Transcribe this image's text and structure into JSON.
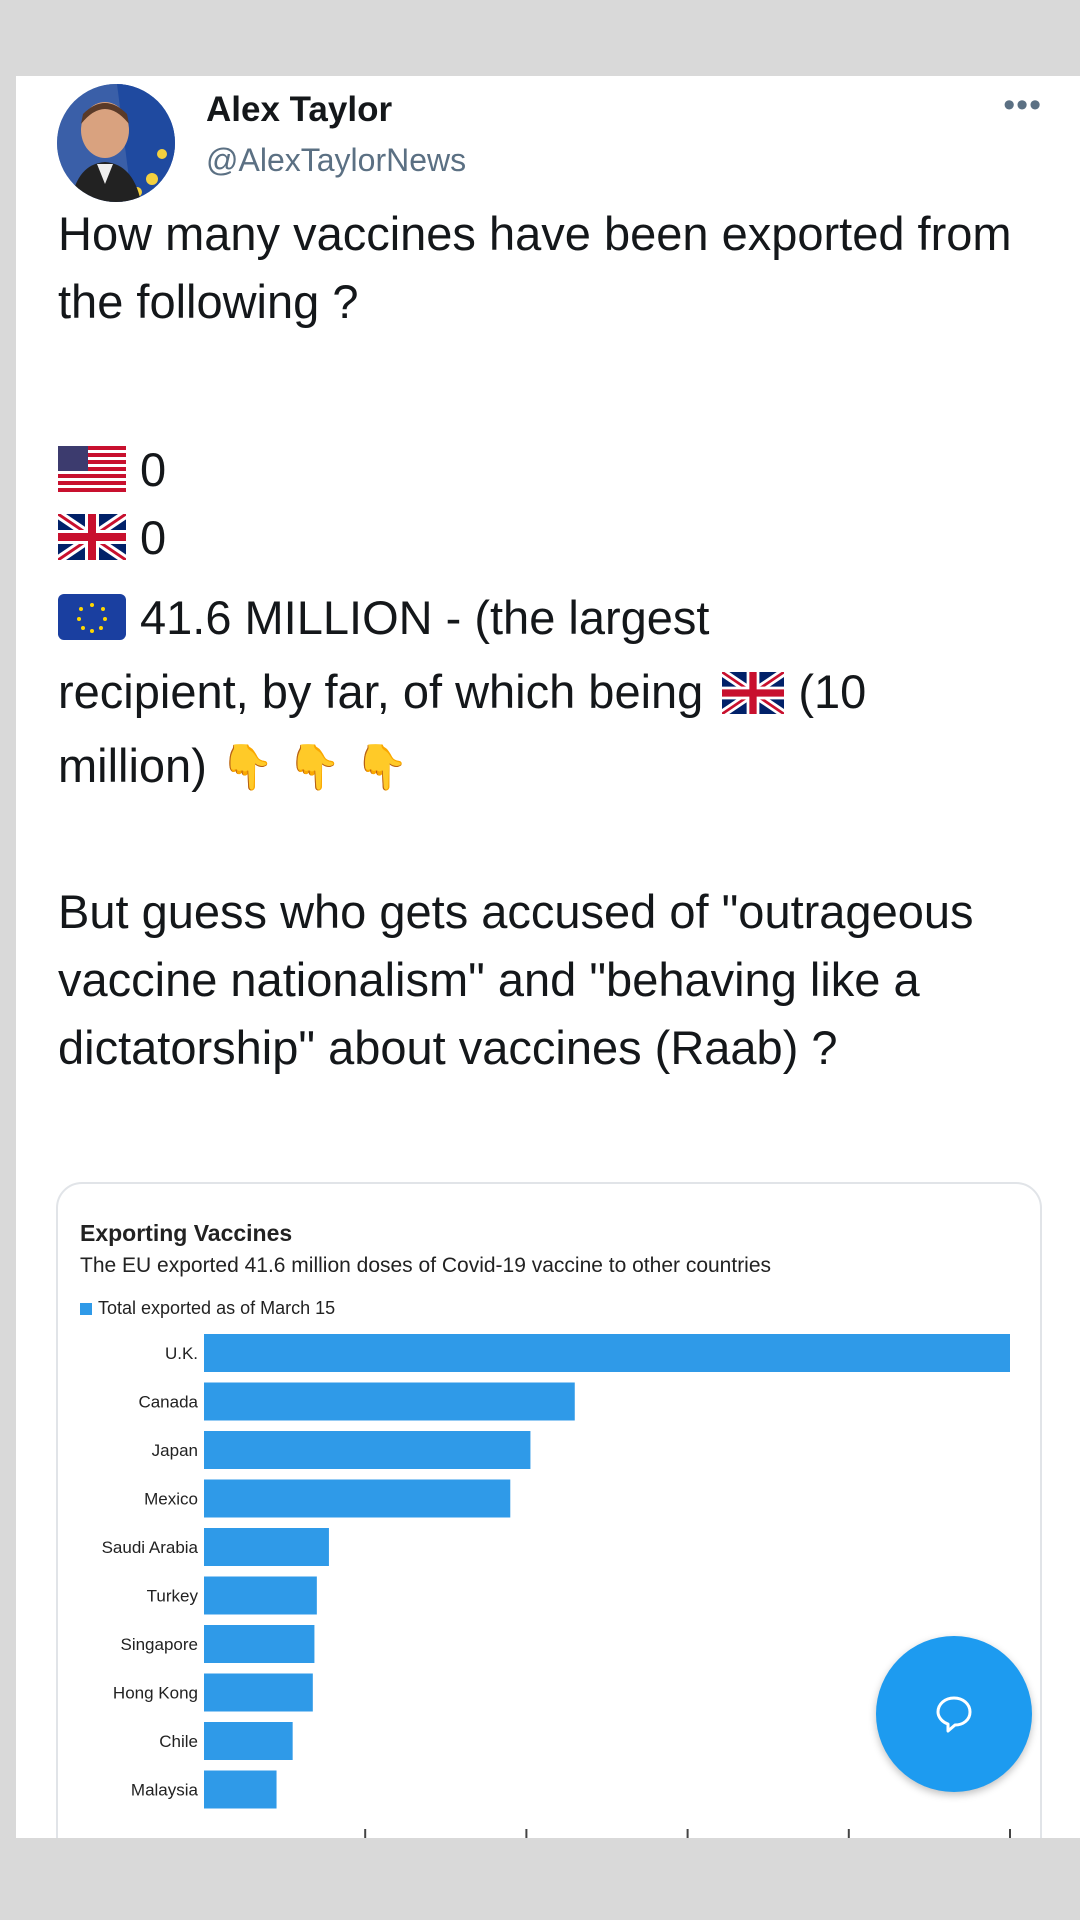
{
  "user": {
    "name": "Alex Taylor",
    "handle": "@AlexTaylorNews",
    "more_label": "•••"
  },
  "tweet": {
    "question": "How many vaccines have been exported from the following ?",
    "us_line": "0",
    "uk_line": "0",
    "eu_line_part1": "41.6 MILLION - (the largest",
    "eu_line_part2": "recipient, by far, of which being",
    "eu_line_part3": "(10",
    "eu_line_part4": "million)",
    "pointing_emoji": "👇 👇 👇",
    "closing": "But guess who gets accused of \"outrageous vaccine nationalism\" and \"behaving like a dictatorship\" about vaccines (Raab) ?"
  },
  "icons": {
    "us_flag": "us-flag-icon",
    "uk_flag": "uk-flag-icon",
    "eu_flag": "eu-flag-icon",
    "reply_fab": "speech-bubble-icon",
    "pointing": "pointing-down-emoji"
  },
  "colors": {
    "bar": "#2f9ae8",
    "fab": "#1d9bf0",
    "handle": "#5b7083"
  },
  "chart_data": {
    "type": "bar",
    "orientation": "horizontal",
    "title": "Exporting Vaccines",
    "subtitle": "The EU exported 41.6 million doses of Covid-19 vaccine to other countries",
    "legend": [
      "Total exported as of March 15"
    ],
    "categories": [
      "U.K.",
      "Canada",
      "Japan",
      "Mexico",
      "Saudi Arabia",
      "Turkey",
      "Singapore",
      "Hong Kong",
      "Chile",
      "Malaysia"
    ],
    "series": [
      {
        "name": "Total exported as of March 15",
        "values": [
          10.0,
          4.6,
          4.05,
          3.8,
          1.55,
          1.4,
          1.37,
          1.35,
          1.1,
          0.9
        ]
      }
    ],
    "xlim": [
      0,
      10
    ],
    "xticks": [
      "0",
      "2",
      "4",
      "6",
      "8",
      "10M"
    ],
    "grid": false
  }
}
